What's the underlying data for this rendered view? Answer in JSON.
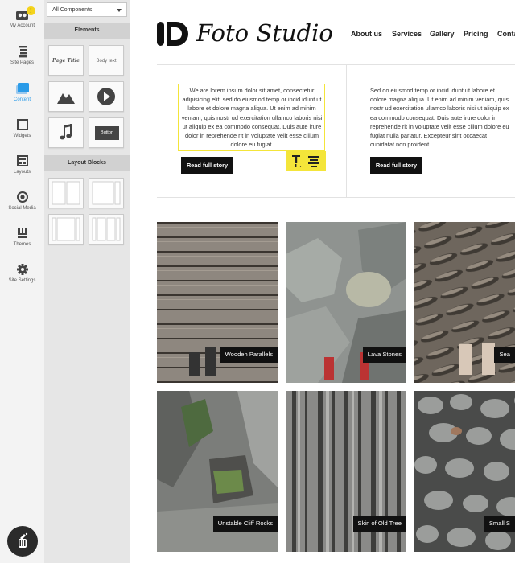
{
  "rail": {
    "items": [
      {
        "label": "My Account",
        "icon": "account-icon",
        "badge": "!"
      },
      {
        "label": "Site Pages",
        "icon": "pages-icon"
      },
      {
        "label": "Content",
        "icon": "content-icon",
        "active": true
      },
      {
        "label": "Widgets",
        "icon": "widgets-icon"
      },
      {
        "label": "Layouts",
        "icon": "layouts-icon"
      },
      {
        "label": "Social Media",
        "icon": "social-icon"
      },
      {
        "label": "Themes",
        "icon": "themes-icon"
      },
      {
        "label": "Site Settings",
        "icon": "settings-icon"
      }
    ],
    "accent_color": "#2a9be8",
    "badge_color": "#f4d31b"
  },
  "panel": {
    "filter_value": "All Components",
    "elements_heading": "Elements",
    "tiles": {
      "page_title": "Page Title",
      "body_text": "Body text",
      "image": "image-icon",
      "video": "video-icon",
      "audio": "music-icon",
      "button": "Button"
    },
    "layout_heading": "Layout Blocks"
  },
  "site": {
    "brand": "Foto Studio",
    "nav": [
      "About us",
      "Services",
      "Gallery",
      "Pricing",
      "Contact"
    ],
    "col1_text": "We are lorem ipsum dolor sit amet, consectetur adipisicing elit, sed do eiusmod temp or incid idunt ut labore et dolore magna aliqua. Ut enim ad minim veniam, quis nostr ud exercitation ullamco laboris nisi ut aliquip ex ea commodo consequat. Duis aute irure dolor in reprehende rit in voluptate velit esse cillum dolore eu fugiat.",
    "col2_text": "Sed do eiusmod temp or incid idunt ut labore et dolore magna aliqua. Ut enim ad minim veniam, quis nostr ud exercitation ullamco laboris nisi ut aliquip ex ea commodo consequat. Duis aute irure dolor in reprehende rit in voluptate velit esse cillum dolore eu fugiat nulla pariatur. Excepteur sint occaecat cupidatat non proident.",
    "read_more": "Read full story",
    "highlight_color": "#f4e53a",
    "gallery": [
      {
        "caption": "Wooden Parallels"
      },
      {
        "caption": "Lava Stones"
      },
      {
        "caption": "Sea"
      },
      {
        "caption": "Unstable Cliff Rocks"
      },
      {
        "caption": "Skin of Old Tree"
      },
      {
        "caption": "Small S"
      }
    ]
  }
}
